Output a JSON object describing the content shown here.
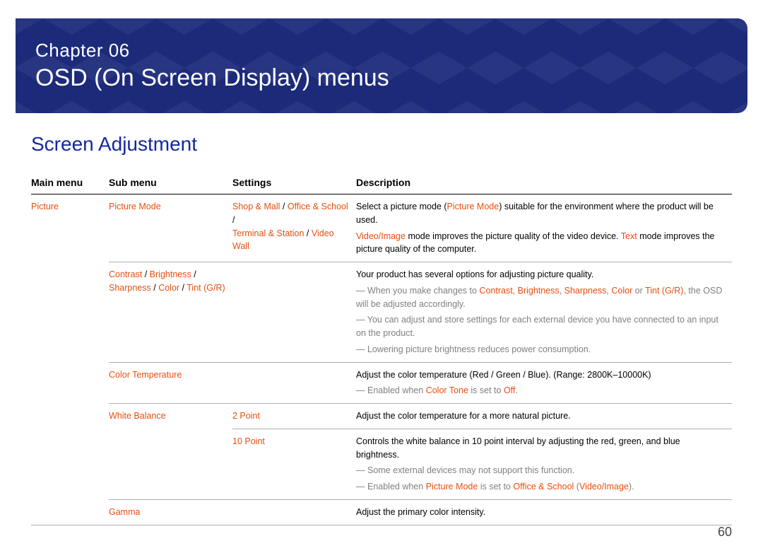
{
  "header": {
    "chapter_label": "Chapter 06",
    "chapter_title": "OSD (On Screen Display) menus"
  },
  "section_title": "Screen Adjustment",
  "columns": {
    "main": "Main menu",
    "sub": "Sub menu",
    "settings": "Settings",
    "desc": "Description"
  },
  "rows": {
    "r1": {
      "main": "Picture",
      "sub": "Picture Mode",
      "settings": {
        "a": "Shop & Mall",
        "b": "Office & School",
        "c": "Terminal & Station",
        "d": "Video Wall",
        "sep": " / "
      },
      "desc": {
        "l1a": "Select a picture mode (",
        "l1b": "Picture Mode",
        "l1c": ") suitable for the environment where the product will be used.",
        "l2a": "Video/Image",
        "l2b": " mode improves the picture quality of the video device. ",
        "l2c": "Text",
        "l2d": " mode improves the picture quality of the computer."
      }
    },
    "r2": {
      "sub": {
        "a": "Contrast",
        "b": "Brightness",
        "c": "Sharpness",
        "d": "Color",
        "e": "Tint (G/R)",
        "sep": " / "
      },
      "desc": {
        "l1": "Your product has several options for adjusting picture quality.",
        "n1a": "When you make changes to ",
        "n1b": "Contrast",
        "n1c": "Brightness",
        "n1d": "Sharpness",
        "n1e": "Color",
        "n1f": "Tint (G/R)",
        "n1g": ", the OSD will be adjusted accordingly.",
        "n1sep": ", ",
        "n1or": " or ",
        "n2": "You can adjust and store settings for each external device you have connected to an input on the product.",
        "n3": "Lowering picture brightness reduces power consumption."
      }
    },
    "r3": {
      "sub": "Color Temperature",
      "desc": {
        "l1": "Adjust the color temperature (Red / Green / Blue). (Range: 2800K–10000K)",
        "n1a": "Enabled when ",
        "n1b": "Color Tone",
        "n1c": " is set to ",
        "n1d": "Off",
        "n1e": "."
      }
    },
    "r4": {
      "sub": "White Balance",
      "settings": "2 Point",
      "desc": "Adjust the color temperature for a more natural picture."
    },
    "r5": {
      "settings": "10 Point",
      "desc": {
        "l1": "Controls the white balance in 10 point interval by adjusting the red, green, and blue brightness.",
        "n1": "Some external devices may not support this function.",
        "n2a": "Enabled when ",
        "n2b": "Picture Mode",
        "n2c": " is set to ",
        "n2d": "Office & School",
        "n2e": " (",
        "n2f": "Video/Image",
        "n2g": ")."
      }
    },
    "r6": {
      "sub": "Gamma",
      "desc": "Adjust the primary color intensity."
    }
  },
  "page_number": "60"
}
